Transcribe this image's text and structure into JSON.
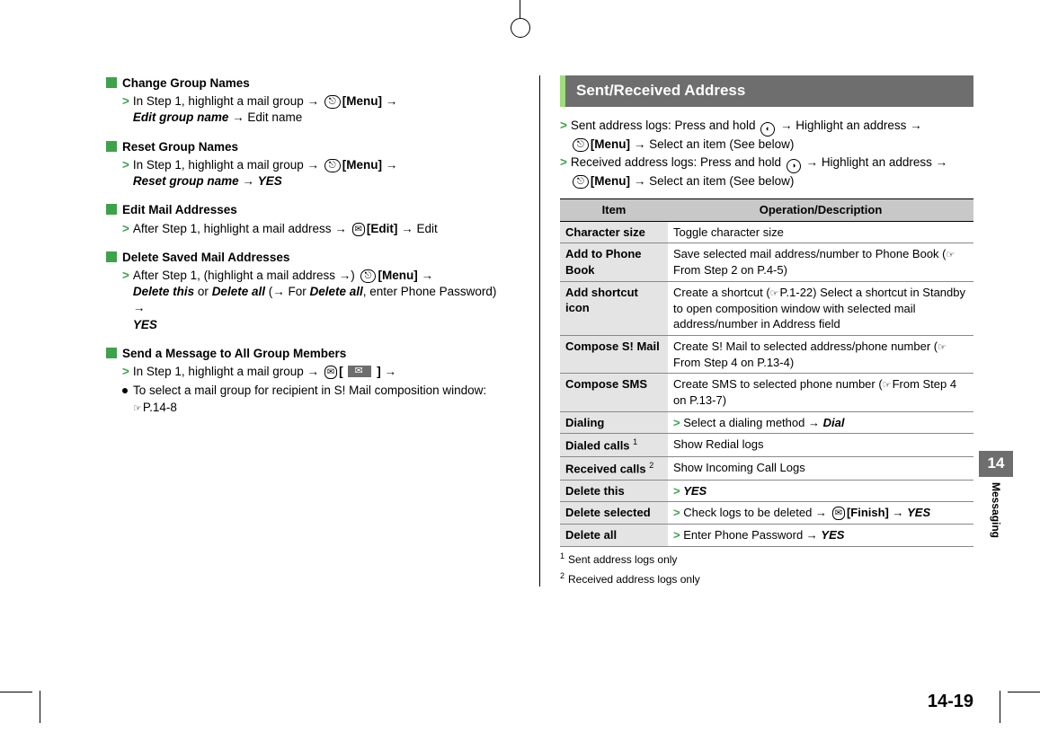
{
  "pageNumber": "14-19",
  "chapterNumber": "14",
  "chapterLabel": "Messaging",
  "left": {
    "sections": [
      {
        "title": "Change Group Names",
        "step_pre": "In Step 1, highlight a mail group",
        "key": "[Menu]",
        "line2a": "Edit group name",
        "line2b": "Edit name"
      },
      {
        "title": "Reset Group Names",
        "step_pre": "In Step 1, highlight a mail group",
        "key": "[Menu]",
        "line2a": "Reset group name",
        "line2b": "YES"
      },
      {
        "title": "Edit Mail Addresses",
        "single_pre": "After Step 1, highlight a mail address",
        "single_key": "[Edit]",
        "single_post": "Edit"
      },
      {
        "title": "Delete Saved Mail Addresses",
        "del_pre": "After Step 1, (highlight a mail address",
        "del_close": ")",
        "del_key": "[Menu]",
        "del_line2a": "Delete this",
        "del_or": " or ",
        "del_line2b": "Delete all",
        "del_paren": " (",
        "del_for": "For ",
        "del_line2c": "Delete all",
        "del_line2d": ", enter Phone Password)",
        "del_line3": "YES"
      },
      {
        "title": "Send a Message to All Group Members",
        "sm_pre": "In Step 1, highlight a mail group",
        "sm_brL": "[",
        "sm_brR": "]",
        "bullet_text": "To select a mail group for recipient in S! Mail composition window:",
        "bullet_ref": "P.14-8"
      }
    ]
  },
  "right": {
    "heading": "Sent/Received Address",
    "sent_pre": "Sent address logs: Press and hold",
    "sent_mid": "Highlight an address",
    "sent_key": "[Menu]",
    "sent_post": "Select an item (See below)",
    "recv_pre": "Received address logs: Press and hold",
    "recv_mid": "Highlight an address",
    "recv_key": "[Menu]",
    "recv_post": "Select an item (See below)",
    "table": {
      "headItem": "Item",
      "headOp": "Operation/Description",
      "rows": [
        {
          "item": "Character size",
          "op": "Toggle character size"
        },
        {
          "item": "Add to Phone Book",
          "op": "Save selected mail address/number to Phone Book (",
          "ref": "From Step 2 on P.4-5",
          "opEnd": ")"
        },
        {
          "item": "Add shortcut icon",
          "op": "Create a shortcut (",
          "ref": "P.1-22",
          "opMid": ") Select a shortcut in Standby to open composition window with selected mail address/number in Address field"
        },
        {
          "item": "Compose S! Mail",
          "op": "Create S! Mail to selected address/phone number (",
          "ref": "From Step 4 on P.13-4",
          "opEnd": ")"
        },
        {
          "item": "Compose SMS",
          "op": "Create SMS to selected phone number (",
          "ref": "From Step 4 on P.13-7",
          "opEnd": ")"
        },
        {
          "item": "Dialing",
          "chev": "Select a dialing method",
          "chevBold": "Dial"
        },
        {
          "item": "Dialed calls",
          "sup": "1",
          "op": "Show Redial logs"
        },
        {
          "item": "Received calls",
          "sup": "2",
          "op": "Show Incoming Call Logs"
        },
        {
          "item": "Delete this",
          "chevBoldOnly": "YES"
        },
        {
          "item": "Delete selected",
          "chev": "Check logs to be deleted",
          "keyLabel": "[Finish]",
          "chevBold": "YES"
        },
        {
          "item": "Delete all",
          "chev": "Enter Phone Password",
          "chevBold": "YES"
        }
      ]
    },
    "fn1n": "1",
    "fn1": "Sent address logs only",
    "fn2n": "2",
    "fn2": "Received address logs only"
  }
}
